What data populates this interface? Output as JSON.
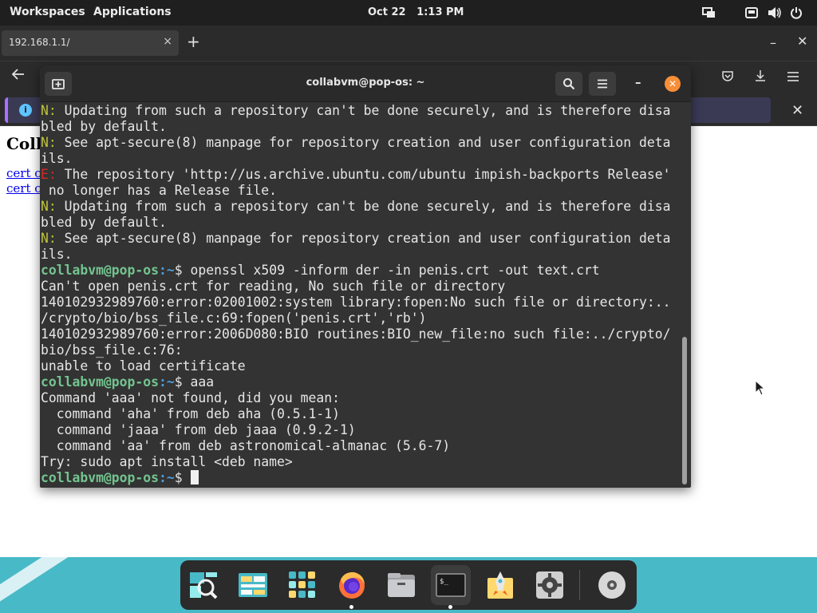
{
  "topbar": {
    "workspaces": "Workspaces",
    "applications": "Applications",
    "date": "Oct 22",
    "time": "1:13 PM"
  },
  "browser": {
    "tab_title": "192.168.1.1/",
    "tab_close": "×",
    "new_tab": "+",
    "minimize": "–",
    "close": "✕",
    "notification_close": "✕"
  },
  "page": {
    "heading": "Coll",
    "link1": "cert c",
    "link2": "cert c"
  },
  "terminal": {
    "title": "collabvm@pop-os: ~",
    "prompt_user": "collabvm@pop-os",
    "prompt_path": ":~",
    "prompt_symbol": "$ ",
    "lines": [
      {
        "prefix": "N:",
        "kind": "warn",
        "text": " Updating from such a repository can't be done securely, and is therefore disa"
      },
      {
        "prefix": "",
        "kind": "plain",
        "text": "bled by default."
      },
      {
        "prefix": "N:",
        "kind": "warn",
        "text": " See apt-secure(8) manpage for repository creation and user configuration deta"
      },
      {
        "prefix": "",
        "kind": "plain",
        "text": "ils."
      },
      {
        "prefix": "E:",
        "kind": "err",
        "text": " The repository 'http://us.archive.ubuntu.com/ubuntu impish-backports Release'"
      },
      {
        "prefix": "",
        "kind": "plain",
        "text": " no longer has a Release file."
      },
      {
        "prefix": "N:",
        "kind": "warn",
        "text": " Updating from such a repository can't be done securely, and is therefore disa"
      },
      {
        "prefix": "",
        "kind": "plain",
        "text": "bled by default."
      },
      {
        "prefix": "N:",
        "kind": "warn",
        "text": " See apt-secure(8) manpage for repository creation and user configuration deta"
      },
      {
        "prefix": "",
        "kind": "plain",
        "text": "ils."
      },
      {
        "prefix": "",
        "kind": "prompt",
        "text": "openssl x509 -inform der -in penis.crt -out text.crt"
      },
      {
        "prefix": "",
        "kind": "plain",
        "text": "Can't open penis.crt for reading, No such file or directory"
      },
      {
        "prefix": "",
        "kind": "plain",
        "text": "140102932989760:error:02001002:system library:fopen:No such file or directory:.."
      },
      {
        "prefix": "",
        "kind": "plain",
        "text": "/crypto/bio/bss_file.c:69:fopen('penis.crt','rb')"
      },
      {
        "prefix": "",
        "kind": "plain",
        "text": "140102932989760:error:2006D080:BIO routines:BIO_new_file:no such file:../crypto/"
      },
      {
        "prefix": "",
        "kind": "plain",
        "text": "bio/bss_file.c:76:"
      },
      {
        "prefix": "",
        "kind": "plain",
        "text": "unable to load certificate"
      },
      {
        "prefix": "",
        "kind": "prompt",
        "text": "aaa"
      },
      {
        "prefix": "",
        "kind": "plain",
        "text": "Command 'aaa' not found, did you mean:"
      },
      {
        "prefix": "",
        "kind": "plain",
        "text": "  command 'aha' from deb aha (0.5.1-1)"
      },
      {
        "prefix": "",
        "kind": "plain",
        "text": "  command 'jaaa' from deb jaaa (0.9.2-1)"
      },
      {
        "prefix": "",
        "kind": "plain",
        "text": "  command 'aa' from deb astronomical-almanac (5.6-7)"
      },
      {
        "prefix": "",
        "kind": "plain",
        "text": "Try: sudo apt install <deb name>"
      },
      {
        "prefix": "",
        "kind": "prompt_cursor",
        "text": ""
      }
    ]
  },
  "dock": {
    "items": [
      {
        "name": "search-app-icon",
        "running": false
      },
      {
        "name": "files-app-icon",
        "running": false
      },
      {
        "name": "app-grid-icon",
        "running": false
      },
      {
        "name": "firefox-icon",
        "running": true
      },
      {
        "name": "file-manager-icon",
        "running": false
      },
      {
        "name": "terminal-icon",
        "running": true
      },
      {
        "name": "pop-shop-icon",
        "running": false
      },
      {
        "name": "settings-icon",
        "running": false
      },
      {
        "name": "disc-icon",
        "running": false
      }
    ]
  },
  "colors": {
    "warn": "#bfc33a",
    "error": "#d12b2b",
    "prompt_user": "#73c48f",
    "prompt_path": "#4e9bd6",
    "close_button": "#f78f38",
    "wallpaper": "#48b9c7"
  }
}
